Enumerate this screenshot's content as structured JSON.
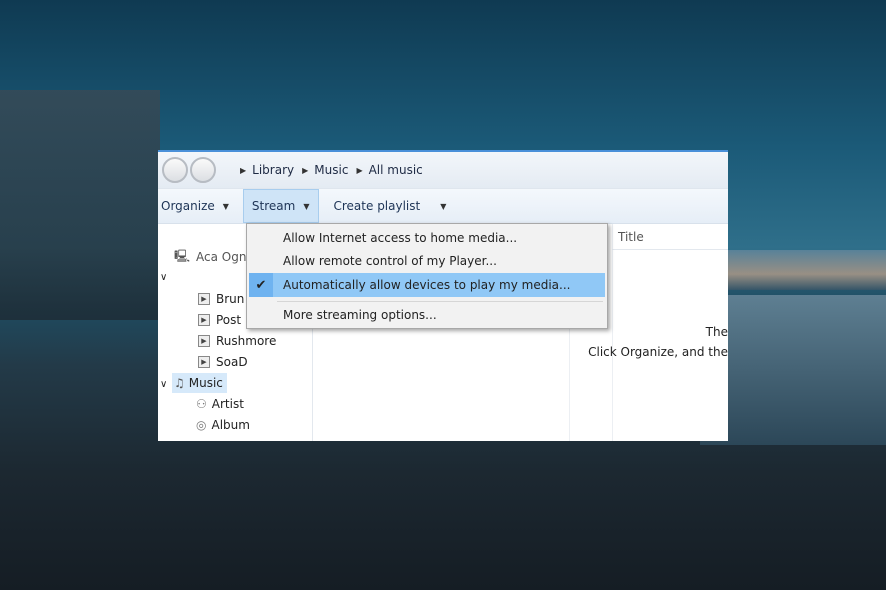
{
  "address": {
    "crumbs": [
      "Library",
      "Music",
      "All music"
    ]
  },
  "toolbar": {
    "organize": "Organize",
    "stream": "Stream",
    "create_playlist": "Create playlist"
  },
  "nav": {
    "user": "Aca Ogn",
    "playlists": [
      "Brun",
      "Post",
      "Rushmore",
      "SoaD"
    ],
    "music": "Music",
    "music_items": [
      "Artist",
      "Album"
    ]
  },
  "list": {
    "title_header": "Title",
    "empty_line1": "The",
    "empty_line2": "Click Organize, and the"
  },
  "stream_menu": {
    "items": [
      {
        "label": "Allow Internet access to home media...",
        "checked": false
      },
      {
        "label": "Allow remote control of my Player...",
        "checked": false
      },
      {
        "label": "Automatically allow devices to play my media...",
        "checked": true
      },
      {
        "label": "More streaming options...",
        "checked": false
      }
    ]
  },
  "colors": {
    "highlight": "#90c8f6",
    "accent": "#4a90d9"
  }
}
